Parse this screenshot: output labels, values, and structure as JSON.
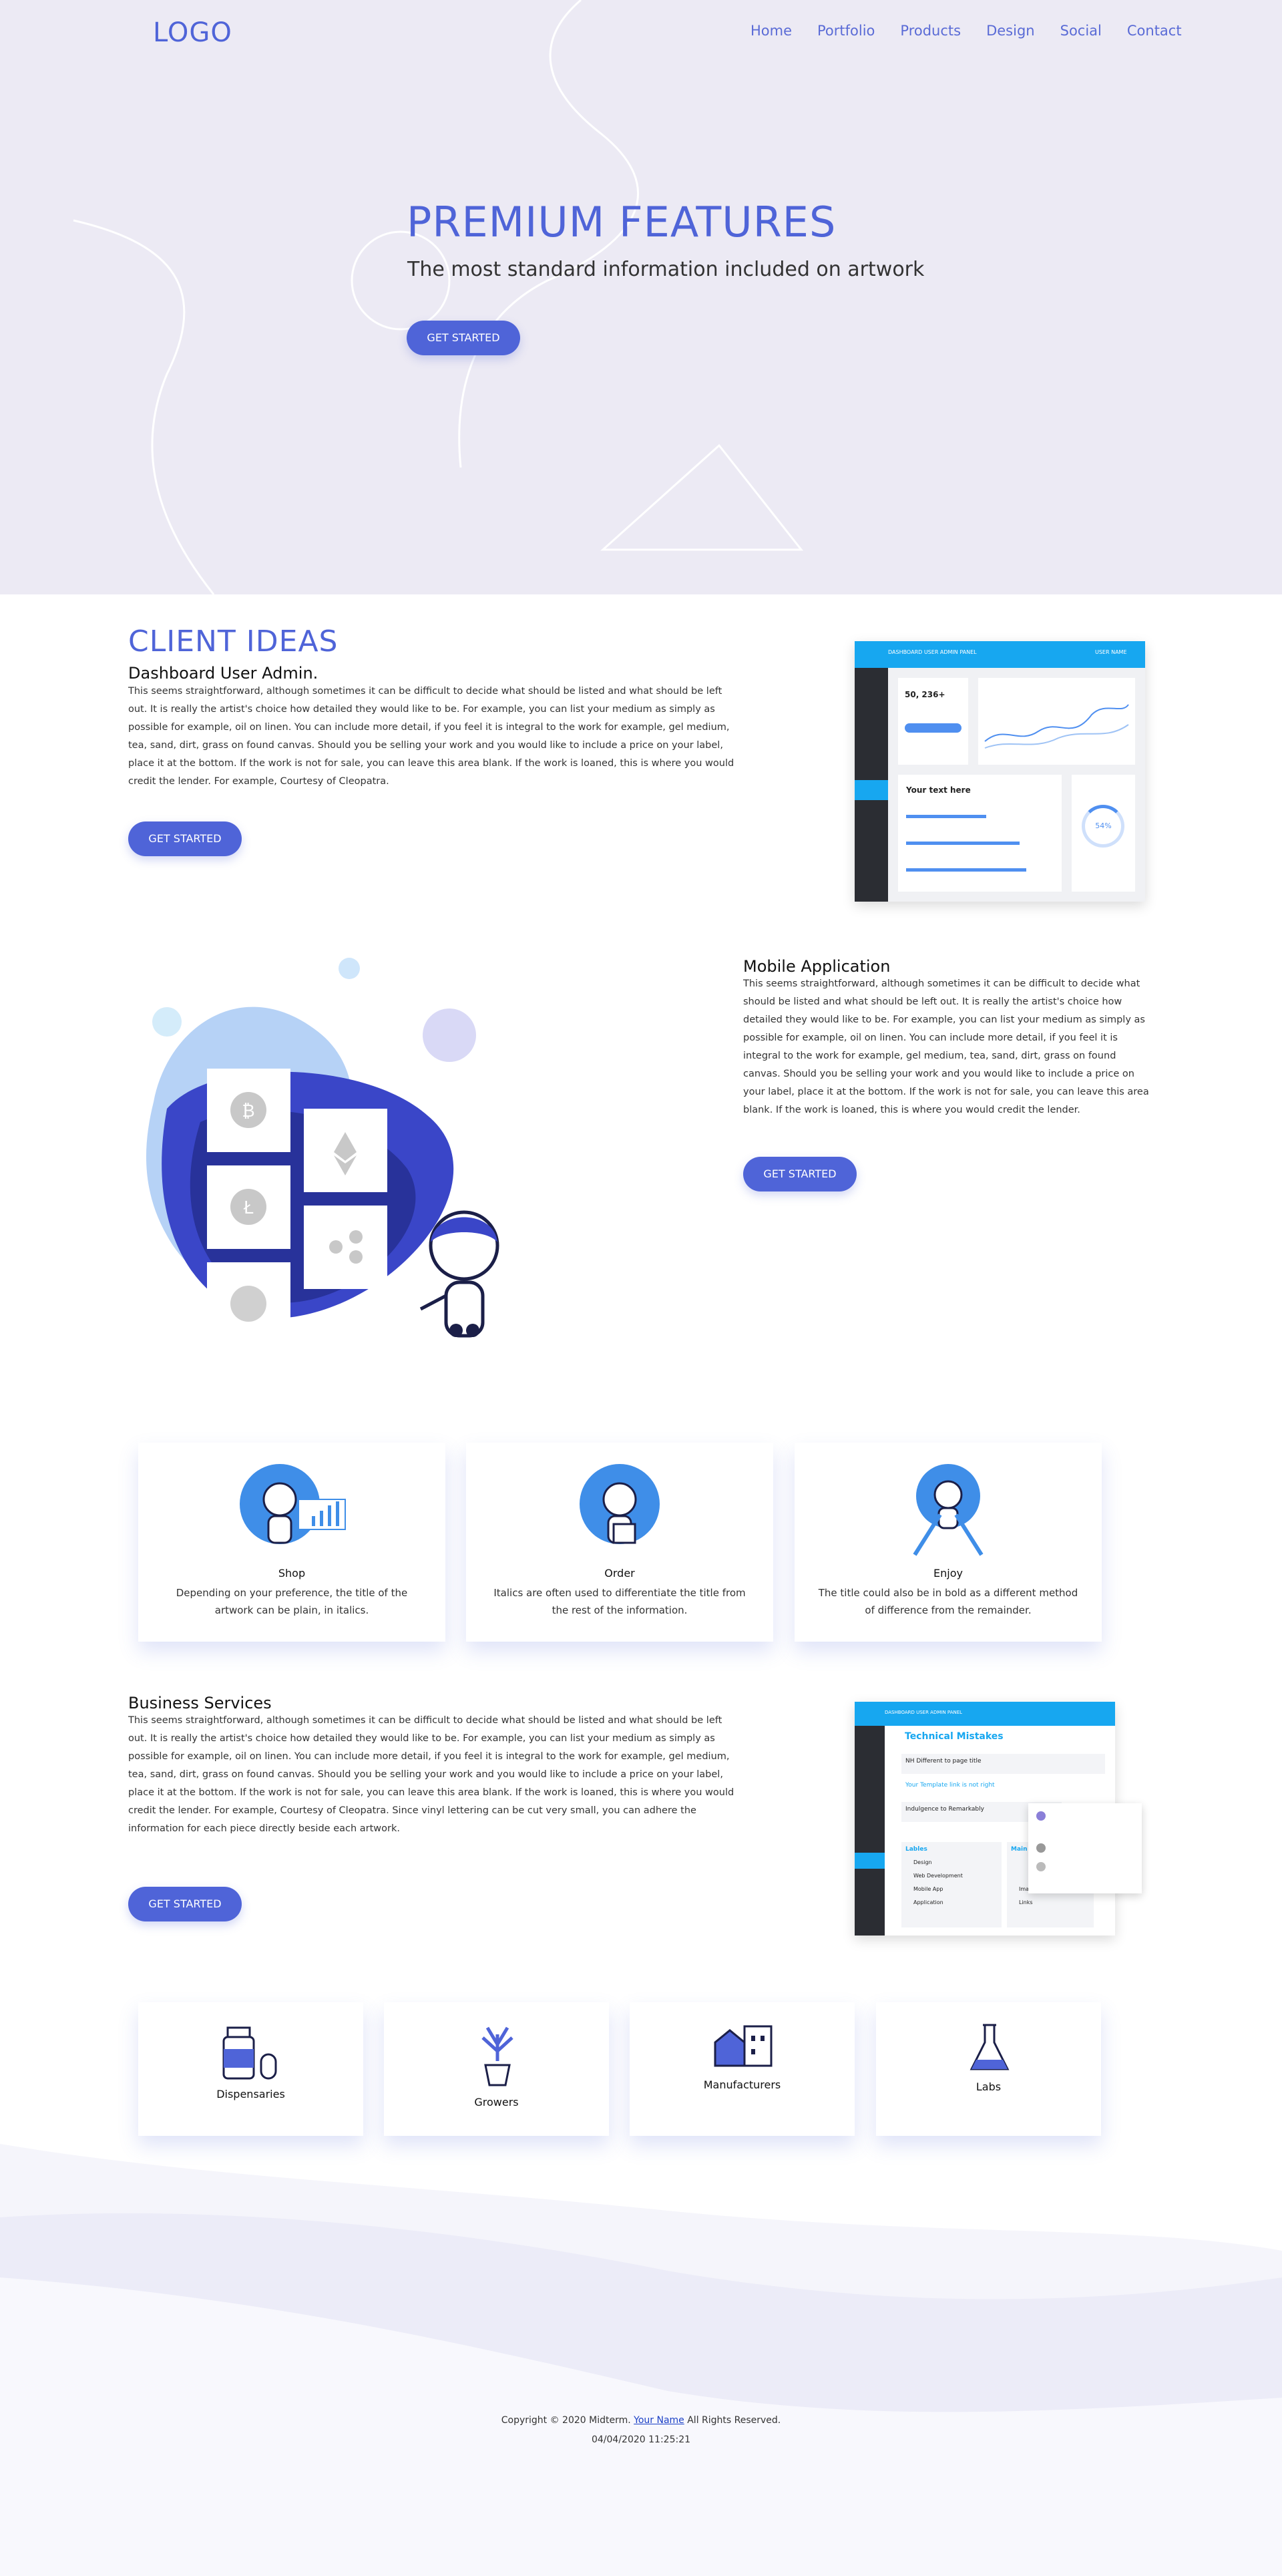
{
  "header": {
    "logo": "LOGO",
    "nav": [
      "Home",
      "Portfolio",
      "Products",
      "Design",
      "Social",
      "Contact"
    ]
  },
  "hero": {
    "title": "PREMIUM FEATURES",
    "subtitle": "The most standard information included on artwork",
    "cta": "GET STARTED"
  },
  "client": {
    "heading": "CLIENT IDEAS",
    "subheading": "Dashboard User Admin.",
    "body": "This seems straightforward, although sometimes it can be difficult to decide what should be listed and what should be left out. It is really the artist's choice how detailed they would like to be. For example, you can list your medium as simply as possible for example, oil on linen. You can include more detail, if you feel it is integral to the work for example, gel medium, tea, sand, dirt, grass on found canvas. Should you be selling your work and you would like to include a price on your label, place it at the bottom. If the work is not for sale, you can leave this area blank. If the work is loaned, this is where you would credit the lender. For example, Courtesy of Cleopatra.",
    "cta": "GET STARTED",
    "mock": {
      "bar_title": "DASHBOARD USER ADMIN PANEL",
      "user": "USER NAME",
      "stat": "50, 236+",
      "card_title": "Your text here",
      "percent": "54%"
    }
  },
  "mobile": {
    "heading": "Mobile Application",
    "body": "This seems straightforward, although sometimes it can be difficult to decide what should be listed and what should be left out. It is really the artist's choice how detailed they would like to be. For example, you can list your medium as simply as possible for example, oil on linen. You can include more detail, if you feel it is integral to the work for example, gel medium, tea, sand, dirt, grass on found canvas. Should you be selling your work and you would like to include a price on your label, place it at the bottom. If the work is not for sale, you can leave this area blank. If the work is loaned, this is where you would credit the lender.",
    "cta": "GET STARTED"
  },
  "features": [
    {
      "title": "Shop",
      "desc": "Depending on your preference, the title of the artwork can be plain, in italics."
    },
    {
      "title": "Order",
      "desc": "Italics are often used to differentiate the title from the rest of the information."
    },
    {
      "title": "Enjoy",
      "desc": "The title could also be in bold as a different method of difference from the remainder."
    }
  ],
  "business": {
    "heading": "Business Services",
    "body": "This seems straightforward, although sometimes it can be difficult to decide what should be listed and what should be left out. It is really the artist's choice how detailed they would like to be. For example, you can list your medium as simply as possible for example, oil on linen. You can include more detail, if you feel it is integral to the work for example, gel medium, tea, sand, dirt, grass on found canvas. Should you be selling your work and you would like to include a price on your label, place it at the bottom. If the work is not for sale, you can leave this area blank. If the work is loaned, this is where you would credit the lender. For example, Courtesy of Cleopatra. Since vinyl lettering can be cut very small, you can adhere the information for each piece directly beside each artwork.",
    "cta": "GET STARTED",
    "mock": {
      "bar_title": "DASHBOARD USER ADMIN PANEL",
      "panel_title": "Technical Mistakes",
      "rows": [
        "NH Different to page title",
        "Your Template link is not right",
        "Indulgence to Remarkably"
      ],
      "labels_title": "Lables",
      "labels": [
        "Design",
        "Web Development",
        "Mobile App",
        "Application"
      ],
      "main_title": "Main",
      "main_items": [
        "Image",
        "Links"
      ]
    }
  },
  "industries": [
    "Dispensaries",
    "Growers",
    "Manufacturers",
    "Labs"
  ],
  "footer": {
    "copyright_prefix": "Copyright © 2020 Midterm.",
    "link": "Your Name",
    "copyright_suffix": "All Rights Reserved.",
    "timestamp": "04/04/2020 11:25:21"
  },
  "colors": {
    "accent": "#4f64d8",
    "hero_bg": "#eceaf4",
    "mock_bar": "#17a7f0",
    "sidebar": "#2b2d33"
  }
}
